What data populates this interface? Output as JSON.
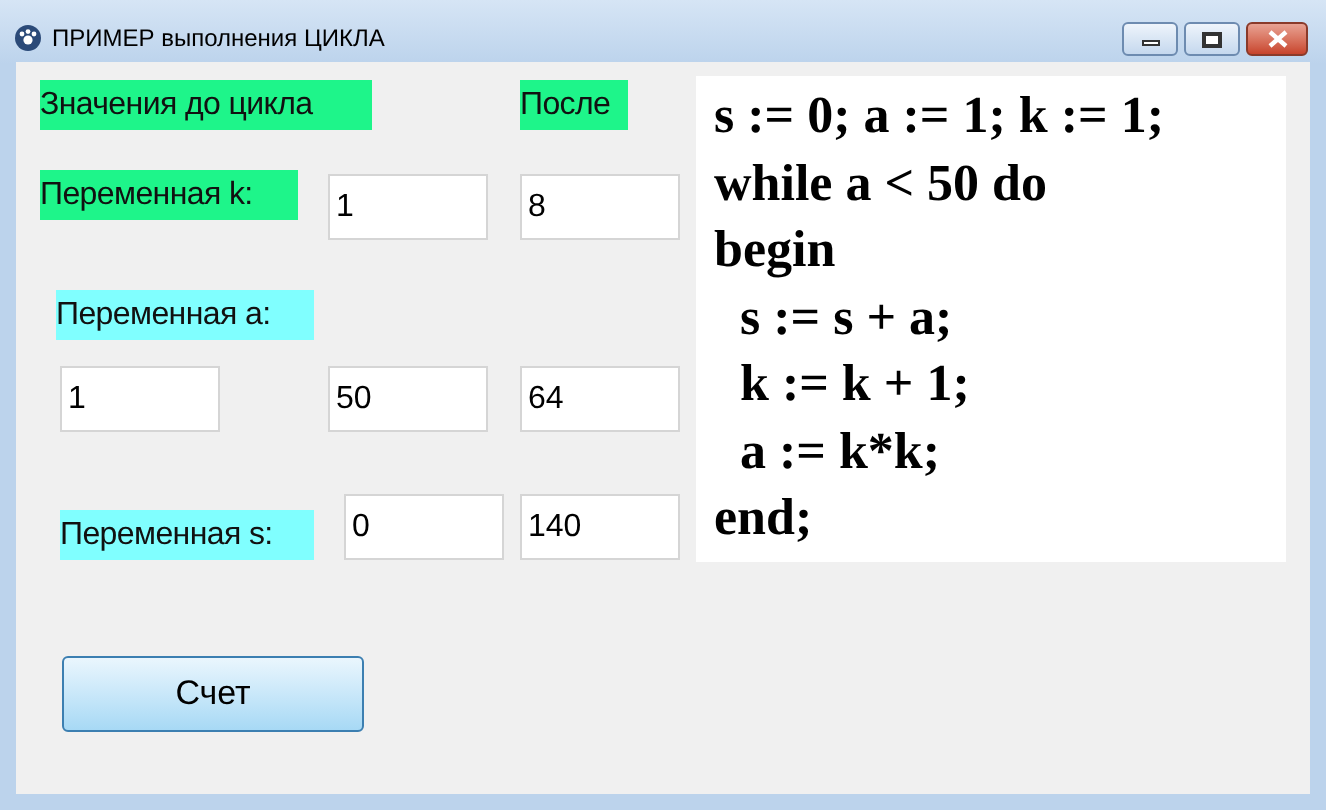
{
  "window": {
    "title": "ПРИМЕР выполнения ЦИКЛА"
  },
  "labels": [
    {
      "text": "Значения до цикла",
      "color": "#1ef58a"
    },
    {
      "text": "После",
      "color": "#1ef58a"
    },
    {
      "text": "Переменная k:",
      "color": "#1ef58a"
    },
    {
      "text": "Переменная а:",
      "color": "#80ffff"
    },
    {
      "text": "Переменная s:",
      "color": "#80ffff"
    }
  ],
  "fields": [
    {
      "value": "1"
    },
    {
      "value": "8"
    },
    {
      "value": "1"
    },
    {
      "value": "50"
    },
    {
      "value": "64"
    },
    {
      "value": "0"
    },
    {
      "value": "140"
    }
  ],
  "code_lines": [
    "s := 0; a := 1; k := 1;",
    "while a < 50 do",
    "begin",
    "  s := s + a;",
    "  k := k + 1;",
    "  a := k*k;",
    "end;"
  ],
  "button": {
    "label": "Счет"
  }
}
